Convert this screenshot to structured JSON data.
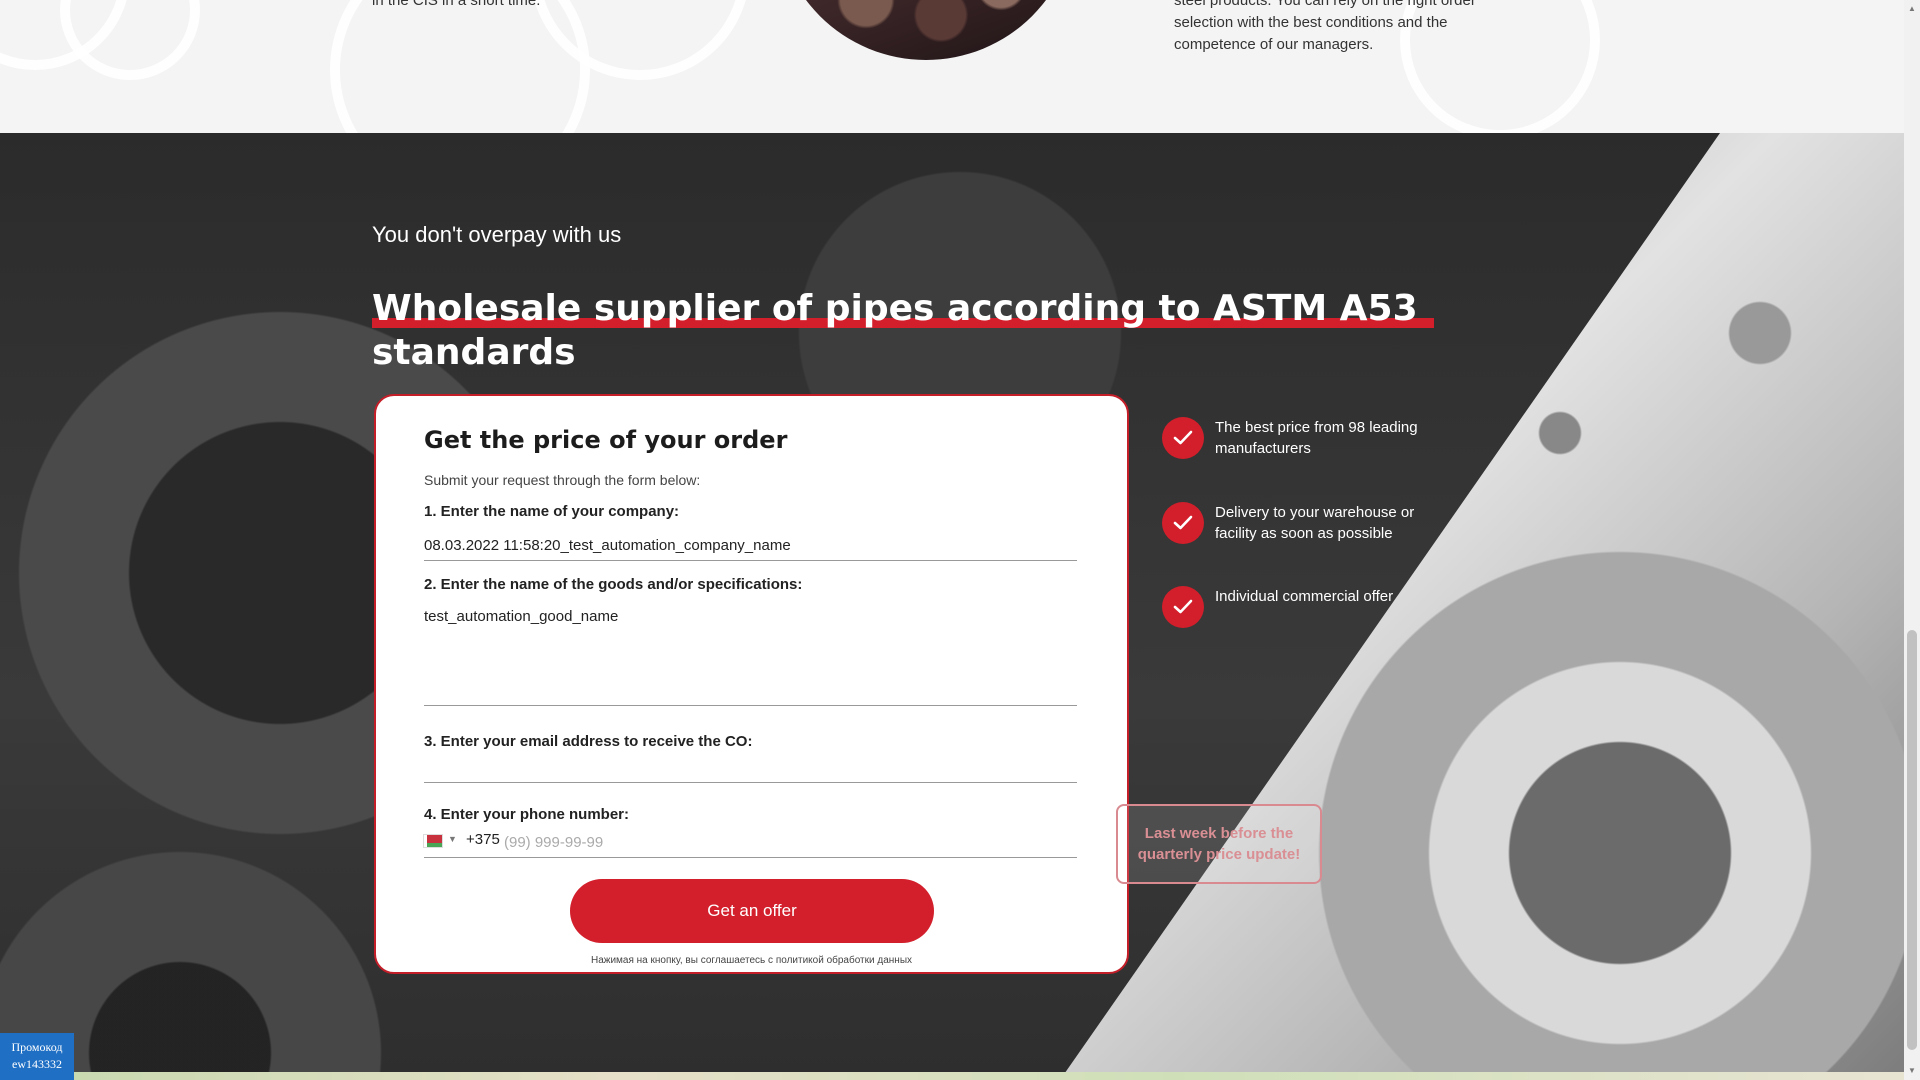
{
  "top": {
    "left_text": "in the CIS in a short time.",
    "right_text": "steel products. You can rely on the right order selection with the best conditions and the competence of our managers."
  },
  "section": {
    "subtitle": "You don't overpay with us",
    "title": "Wholesale supplier of pipes according to ASTM A53 standards"
  },
  "form": {
    "heading": "Get the price of your order",
    "sub": "Submit your request through the form below:",
    "company_label": "1. Enter the name of your company:",
    "company_value": "08.03.2022 11:58:20_test_automation_company_name",
    "goods_label": "2. Enter the name of the goods and/or specifications:",
    "goods_value": "test_automation_good_name",
    "email_label": "3. Enter your email address to receive the CO:",
    "email_value": "",
    "phone_label": "4. Enter your phone number:",
    "phone_code": "+375",
    "phone_placeholder": "(99) 999-99-99",
    "submit_label": "Get an offer",
    "consent": "Нажимая на кнопку, вы соглашаетесь с политикой обработки данных"
  },
  "benefits": [
    {
      "text": "The best price from 98 leading manufacturers",
      "icon": "check-icon"
    },
    {
      "text": "Delivery to your warehouse or facility as soon as possible",
      "icon": "check-icon"
    },
    {
      "text": "Individual commercial offer",
      "icon": "check-icon"
    }
  ],
  "badge": {
    "text": "Last week before the quarterly price update!"
  },
  "promo": {
    "line1": "Промокод",
    "line2": "ew143332"
  },
  "colors": {
    "accent": "#d21f2b",
    "promo_blue": "#1f6fc4",
    "dark_bg": "#2f2f2f"
  }
}
